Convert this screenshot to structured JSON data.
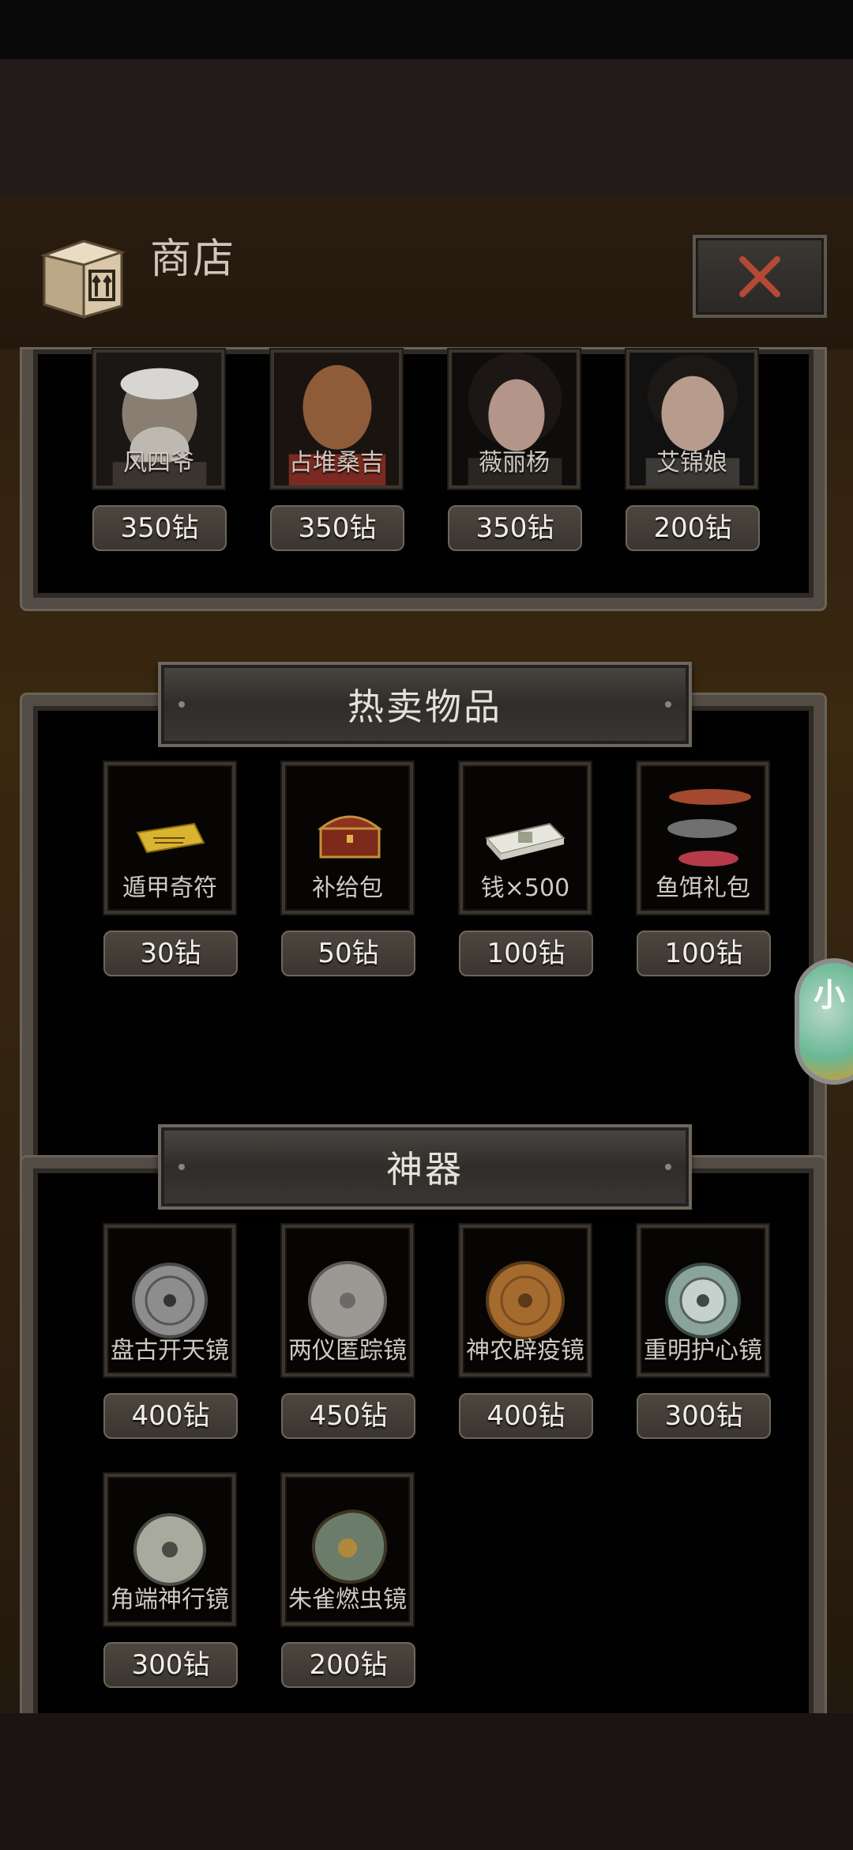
{
  "shop": {
    "title": "商店",
    "close_icon": "close-x-icon",
    "box_icon": "package-box-icon"
  },
  "characters": [
    {
      "name": "风四爷",
      "price": "350钻"
    },
    {
      "name": "占堆桑吉",
      "price": "350钻"
    },
    {
      "name": "薇丽杨",
      "price": "350钻"
    },
    {
      "name": "艾锦娘",
      "price": "200钻"
    }
  ],
  "hot_items": {
    "title": "热卖物品",
    "items": [
      {
        "name": "遁甲奇符",
        "price": "30钻",
        "icon": "talisman-icon"
      },
      {
        "name": "补给包",
        "price": "50钻",
        "icon": "chest-icon"
      },
      {
        "name": "钱×500",
        "price": "100钻",
        "icon": "money-stack-icon"
      },
      {
        "name": "鱼饵礼包",
        "price": "100钻",
        "icon": "fishing-lure-icon"
      }
    ]
  },
  "artifacts": {
    "title": "神器",
    "items": [
      {
        "name": "盘古开天镜",
        "price": "400钻",
        "icon": "bronze-mirror-icon"
      },
      {
        "name": "两仪匿踪镜",
        "price": "450钻",
        "icon": "bronze-mirror-icon"
      },
      {
        "name": "神农辟疫镜",
        "price": "400钻",
        "icon": "bronze-mirror-icon"
      },
      {
        "name": "重明护心镜",
        "price": "300钻",
        "icon": "bronze-mirror-icon"
      },
      {
        "name": "角端神行镜",
        "price": "300钻",
        "icon": "bronze-mirror-icon"
      },
      {
        "name": "朱雀燃虫镜",
        "price": "200钻",
        "icon": "bronze-mirror-icon"
      }
    ]
  },
  "side_widget": {
    "label": "小"
  }
}
